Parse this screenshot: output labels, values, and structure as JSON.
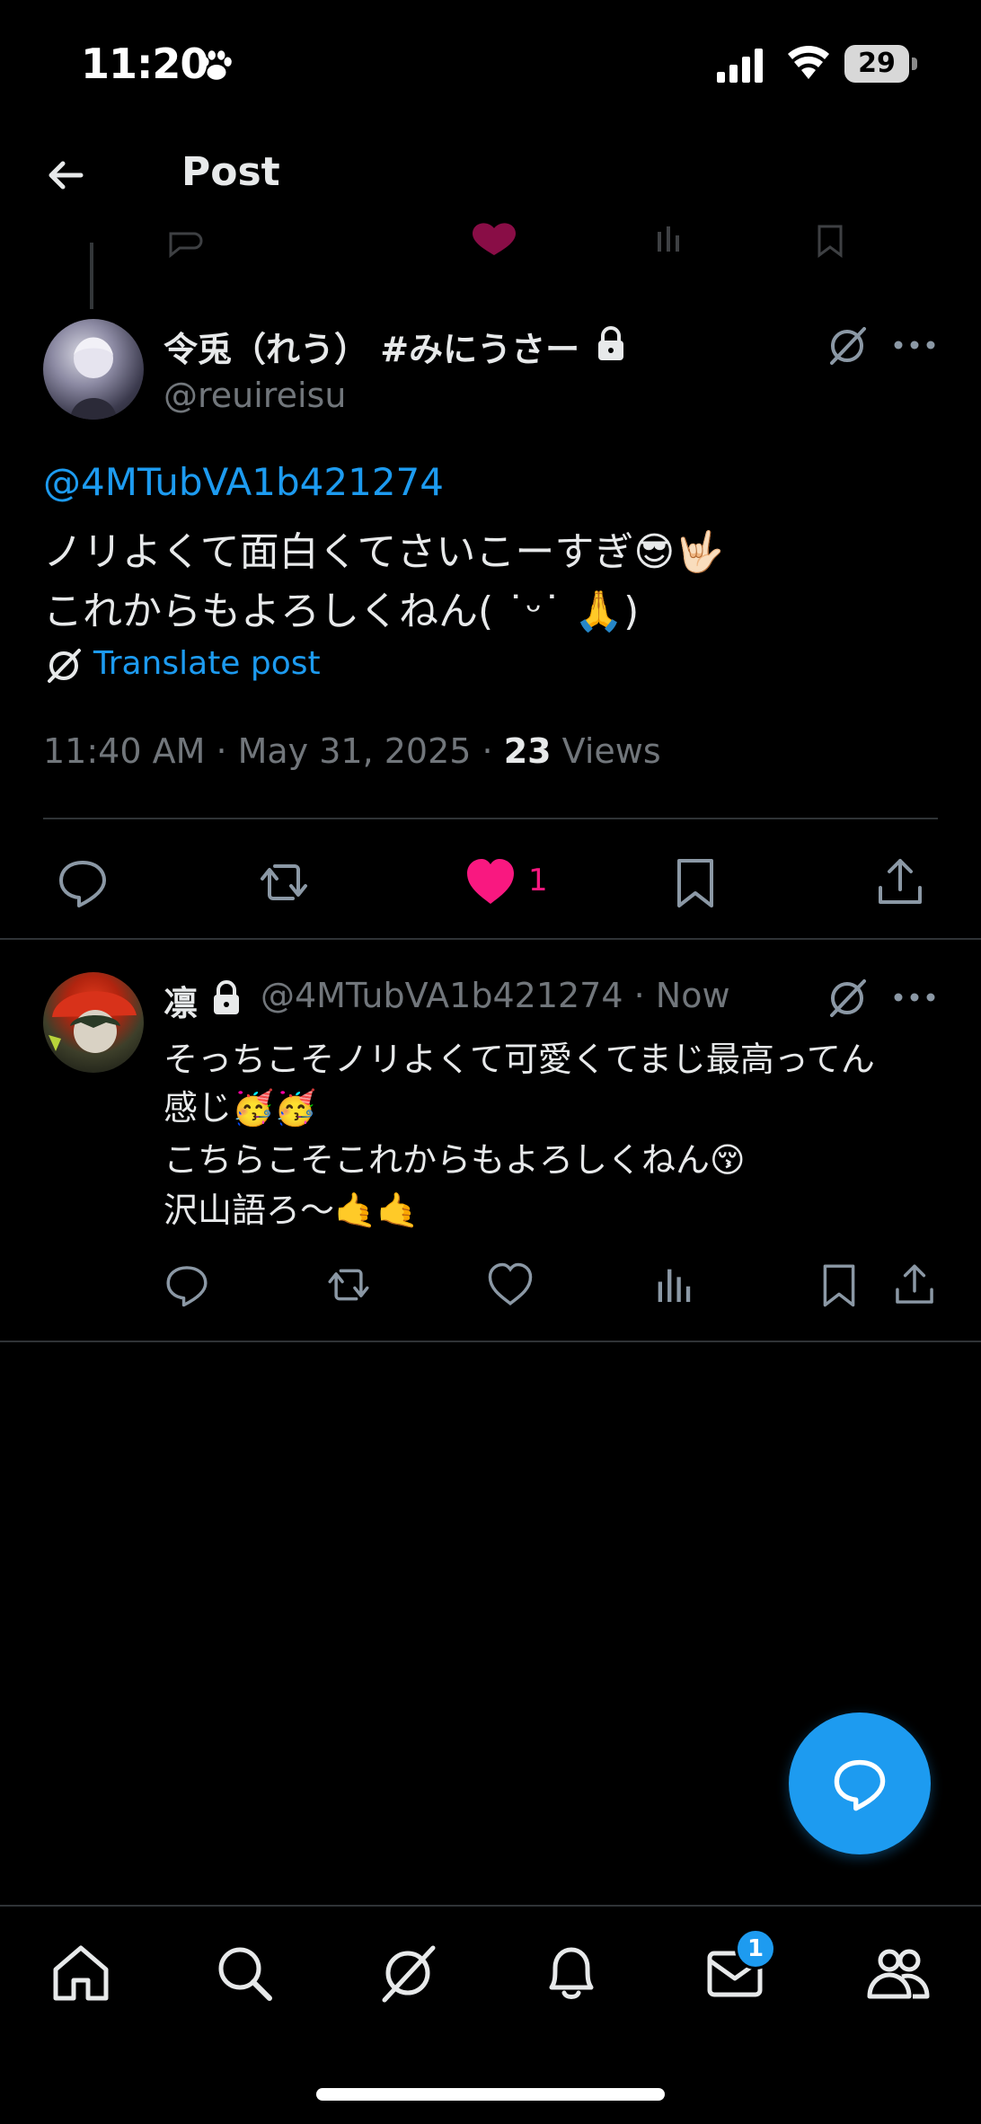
{
  "status_bar": {
    "time": "11:20",
    "battery": "29"
  },
  "header": {
    "title": "Post"
  },
  "main_post": {
    "display_name": "令兎（れう） #みにうさー",
    "handle": "@reuireisu",
    "mention": "@4MTubVA1b421274",
    "body_line1": "ノリよくて面白くてさいこーすぎ😎🤟🏻",
    "body_line2": "これからもよろしくねん( ˙ᵕ˙ 🙏)",
    "translate_label": "Translate post",
    "timestamp": "11:40 AM · May 31, 2025 · ",
    "views_count": "23",
    "views_label": " Views",
    "like_count": "1"
  },
  "reply": {
    "display_name": "凛",
    "handle_and_time": "@4MTubVA1b421274 · Now",
    "line1": "そっちこそノリよくて可愛くてまじ最高ってん",
    "line2": "感じ🥳🥳",
    "line3": "こちらこそこれからもよろしくねん😚",
    "line4": "沢山語ろ〜🤙🤙"
  },
  "nav": {
    "items": [
      "home-icon",
      "search-icon",
      "grok-icon",
      "notifications-icon",
      "messages-icon",
      "communities-icon"
    ],
    "messages_badge": "1"
  },
  "colors": {
    "accent": "#1d9bf0",
    "like": "#f91880",
    "muted": "#71767b",
    "divider": "#2f3336"
  }
}
